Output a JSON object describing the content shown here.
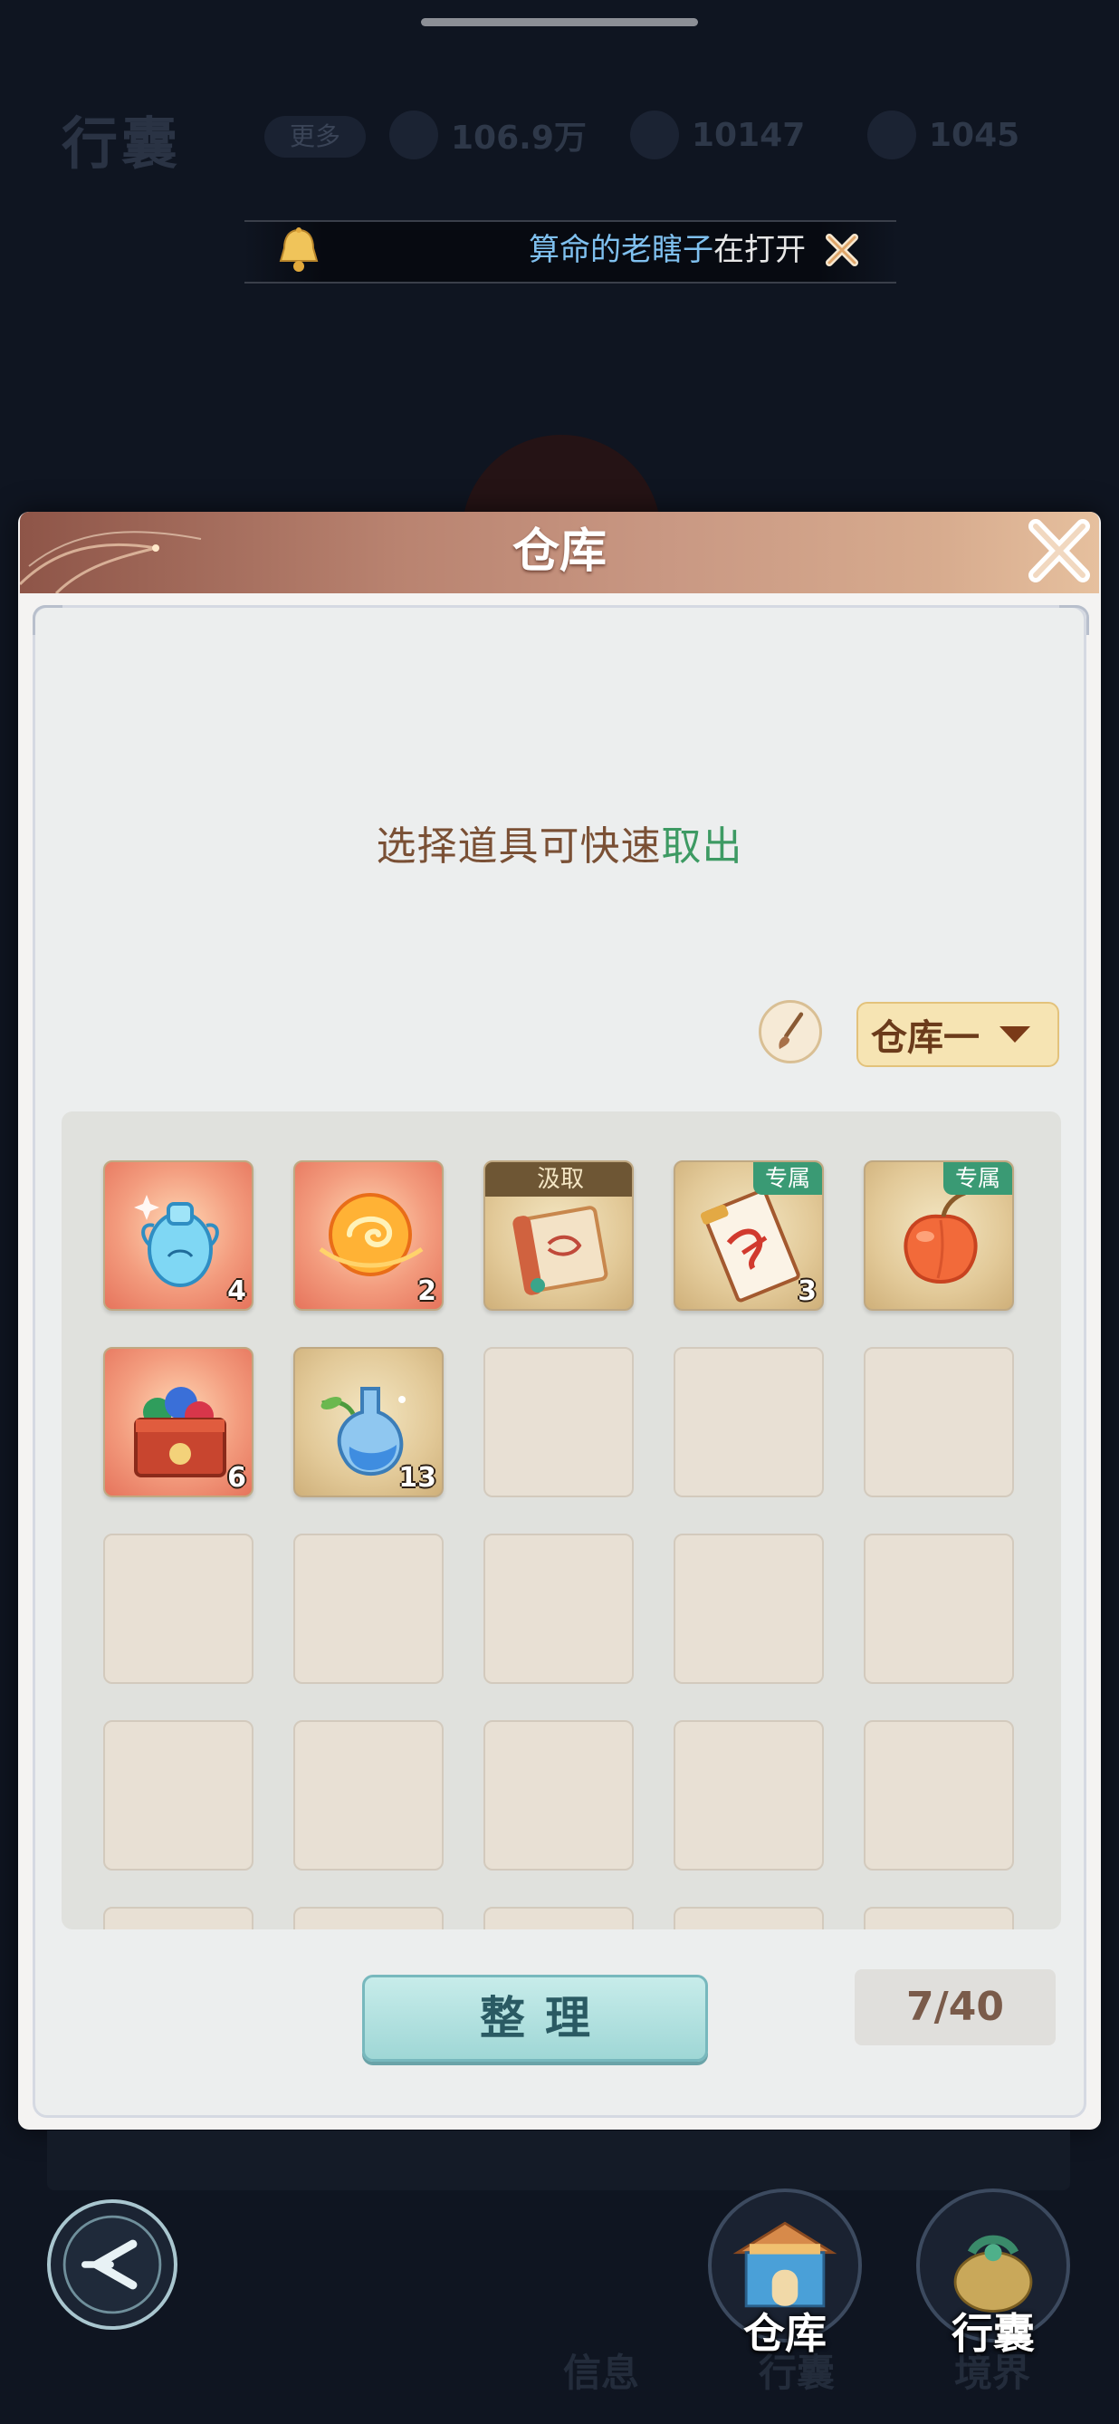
{
  "background": {
    "page_title": "行囊",
    "more_label": "更多",
    "currencies": [
      {
        "icon": "silver-ingot-icon",
        "value": "106.9万"
      },
      {
        "icon": "gold-ingot-icon",
        "value": "10147"
      },
      {
        "icon": "jade-coin-icon",
        "value": "1045"
      }
    ]
  },
  "marquee": {
    "name": "算命的老瞎子",
    "text": "在打开"
  },
  "modal": {
    "title": "仓库",
    "hint_prefix": "选择道具可快速",
    "hint_action": "取出",
    "warehouse_select": "仓库一",
    "sort_label": "整理",
    "capacity": "7/40"
  },
  "items": [
    {
      "name": "blue-vase",
      "qty": "4",
      "rarity": "red",
      "tag": ""
    },
    {
      "name": "fire-orb",
      "qty": "2",
      "rarity": "red",
      "tag": ""
    },
    {
      "name": "scroll",
      "qty": "",
      "rarity": "gold",
      "tag": "汲取"
    },
    {
      "name": "talisman",
      "qty": "3",
      "rarity": "gold",
      "tag": "专属"
    },
    {
      "name": "peach",
      "qty": "",
      "rarity": "gold",
      "tag": "专属"
    },
    {
      "name": "gem-box",
      "qty": "6",
      "rarity": "red",
      "tag": ""
    },
    {
      "name": "potion-bottle",
      "qty": "13",
      "rarity": "gold",
      "tag": ""
    }
  ],
  "nav": {
    "info_label": "信息",
    "bag_label_dim": "行囊",
    "realm_label": "境界",
    "warehouse_label": "仓库",
    "bag_label": "行囊"
  },
  "colors": {
    "accent_green": "#3d9a63",
    "hint_brown": "#7a5035",
    "sort_teal": "#9fd7d6"
  }
}
